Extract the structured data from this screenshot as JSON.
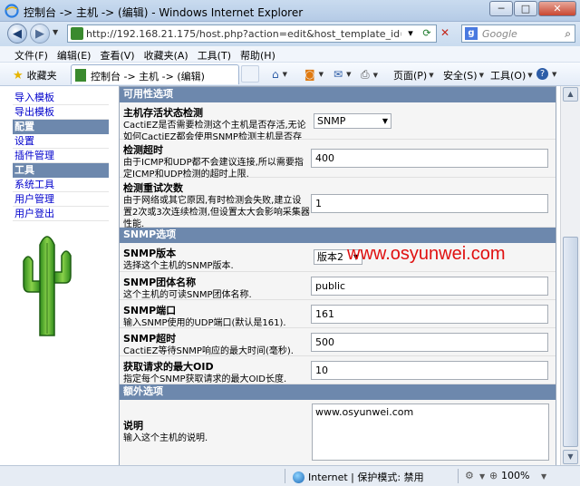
{
  "window": {
    "title": "控制台 -> 主机 -> (编辑) - Windows Internet Explorer",
    "minimize": "─",
    "maximize": "□",
    "close": "✕"
  },
  "address": {
    "url": "http://192.168.21.175/host.php?action=edit&host_template_id=-1&host_sta",
    "search_placeholder": "Google",
    "search_engine_letter": "g"
  },
  "menu": [
    "文件(F)",
    "编辑(E)",
    "查看(V)",
    "收藏夹(A)",
    "工具(T)",
    "帮助(H)"
  ],
  "favorites": {
    "label": "收藏夹",
    "tab_title": "控制台 -> 主机 -> (编辑)"
  },
  "commands": {
    "page": "页面(P)",
    "safety": "安全(S)",
    "tools": "工具(O)"
  },
  "sidebar": {
    "items_top": [
      "导入模板",
      "导出模板"
    ],
    "config_head": "配置",
    "config_items": [
      "设置",
      "插件管理"
    ],
    "tools_head": "工具",
    "tools_items": [
      "系统工具",
      "用户管理",
      "用户登出"
    ]
  },
  "sections": {
    "availability": "可用性选项",
    "snmp": "SNMP选项",
    "extra": "额外选项"
  },
  "fields": {
    "down_detect": {
      "label": "主机存活状态检测",
      "desc": "CactiEZ是否需要检测这个主机是否存活,无论如何CactiEZ都会使用SNMP检测主机是否存活.",
      "value": "SNMP"
    },
    "ping_timeout": {
      "label": "检测超时",
      "desc": "由于ICMP和UDP都不会建议连接,所以需要指定ICMP和UDP检测的超时上限.",
      "value": "400"
    },
    "ping_retries": {
      "label": "检测重试次数",
      "desc": "由于网络或其它原因,有时检测会失败,建立设置2次或3次连续检测,但设置太大会影响采集器性能.",
      "value": "1"
    },
    "snmp_version": {
      "label": "SNMP版本",
      "desc": "选择这个主机的SNMP版本.",
      "value": "版本2"
    },
    "snmp_community": {
      "label": "SNMP团体名称",
      "desc": "这个主机的可读SNMP团体名称.",
      "value": "public"
    },
    "snmp_port": {
      "label": "SNMP端口",
      "desc": "输入SNMP使用的UDP端口(默认是161).",
      "value": "161"
    },
    "snmp_timeout": {
      "label": "SNMP超时",
      "desc": "CactiEZ等待SNMP响应的最大时间(毫秒).",
      "value": "500"
    },
    "max_oids": {
      "label": "获取请求的最大OID",
      "desc": "指定每个SNMP获取请求的最大OID长度.",
      "value": "10"
    },
    "notes": {
      "label": "说明",
      "desc": "输入这个主机的说明.",
      "value": "www.osyunwei.com"
    }
  },
  "watermark": "www.osyunwei.com",
  "status": {
    "zone": "Internet | 保护模式: 禁用",
    "zoom": "100%"
  }
}
